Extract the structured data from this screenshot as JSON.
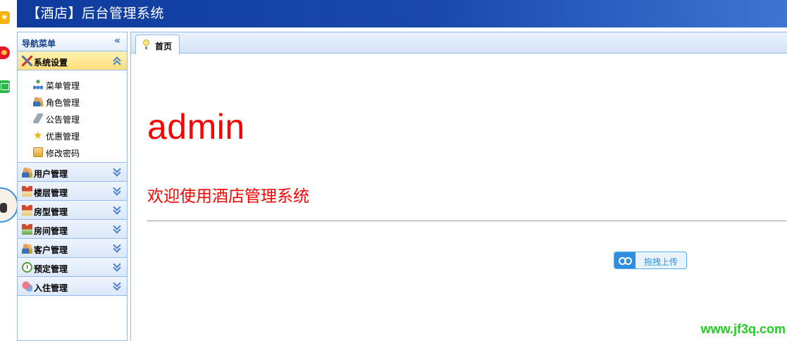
{
  "header": {
    "title": "【酒店】后台管理系统"
  },
  "sidebar": {
    "title": "导航菜单",
    "sections": [
      {
        "label": "系统设置",
        "icon": "tools-icon",
        "expanded": true,
        "items": [
          {
            "label": "菜单管理",
            "icon": "sitemap-icon"
          },
          {
            "label": "角色管理",
            "icon": "users-icon"
          },
          {
            "label": "公告管理",
            "icon": "speaker-icon"
          },
          {
            "label": "优惠管理",
            "icon": "star-icon"
          },
          {
            "label": "修改密码",
            "icon": "key-icon"
          }
        ]
      },
      {
        "label": "用户管理",
        "icon": "users-icon"
      },
      {
        "label": "楼层管理",
        "icon": "house-icon"
      },
      {
        "label": "房型管理",
        "icon": "house-icon"
      },
      {
        "label": "房间管理",
        "icon": "house-green-icon"
      },
      {
        "label": "客户管理",
        "icon": "users-icon"
      },
      {
        "label": "预定管理",
        "icon": "clock-icon"
      },
      {
        "label": "入住管理",
        "icon": "chat-icon"
      }
    ]
  },
  "tabs": [
    {
      "label": "首页",
      "icon": "bulb-icon",
      "active": true
    }
  ],
  "content": {
    "username": "admin",
    "welcome": "欢迎使用酒店管理系统",
    "upload_button": "拖拽上传"
  },
  "watermark": "www.jf3q.com",
  "colors": {
    "header": "#1a49ad",
    "accent_red": "#ff0000",
    "active_section": "#fcdd7a",
    "border": "#99bbe8",
    "watermark": "#22cc22"
  }
}
